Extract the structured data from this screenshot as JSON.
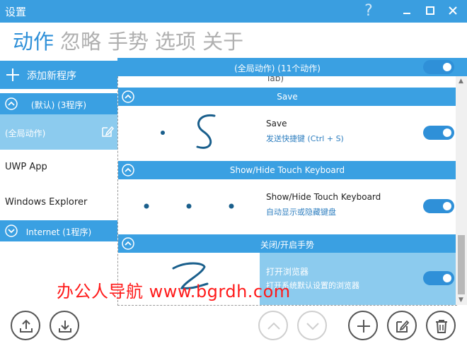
{
  "window": {
    "title": "设置"
  },
  "tabs": [
    {
      "label": "动作",
      "active": true
    },
    {
      "label": "忽略"
    },
    {
      "label": "手势"
    },
    {
      "label": "选项"
    },
    {
      "label": "关于"
    }
  ],
  "sidebar": {
    "add_program_label": "添加新程序",
    "default_group": "(默认) (3程序)",
    "items": [
      "(全局动作)",
      "UWP App",
      "Windows Explorer"
    ],
    "internet_group": "Internet (1程序)"
  },
  "global_header": {
    "label": "(全局动作)  (11个动作)",
    "enabled": true
  },
  "partial_text": "Tab)",
  "sections": [
    {
      "header": "Save",
      "name": "Save",
      "desc": "发送快捷键 (Ctrl + S)",
      "enabled": true
    },
    {
      "header": "Show/Hide Touch Keyboard",
      "name": "Show/Hide Touch Keyboard",
      "desc": "自动显示或隐藏键盘",
      "enabled": true
    },
    {
      "header": "关闭/开启手势",
      "name": "打开浏览器",
      "desc": "打开系统默认设置的浏览器",
      "enabled": true
    }
  ],
  "watermark": "办公人导航 www.bgrdh.com",
  "colors": {
    "accent": "#3aa0e2",
    "selected": "#8ccbee",
    "watermark": "#ff1a1a"
  },
  "icons": {
    "titlebar": [
      "help-icon",
      "minimize-icon",
      "maximize-icon",
      "close-icon"
    ],
    "bottom_left": [
      "upload-icon",
      "download-icon"
    ],
    "bottom_right": [
      "move-up-icon",
      "move-down-icon",
      "add-icon",
      "edit-icon",
      "delete-icon"
    ]
  }
}
